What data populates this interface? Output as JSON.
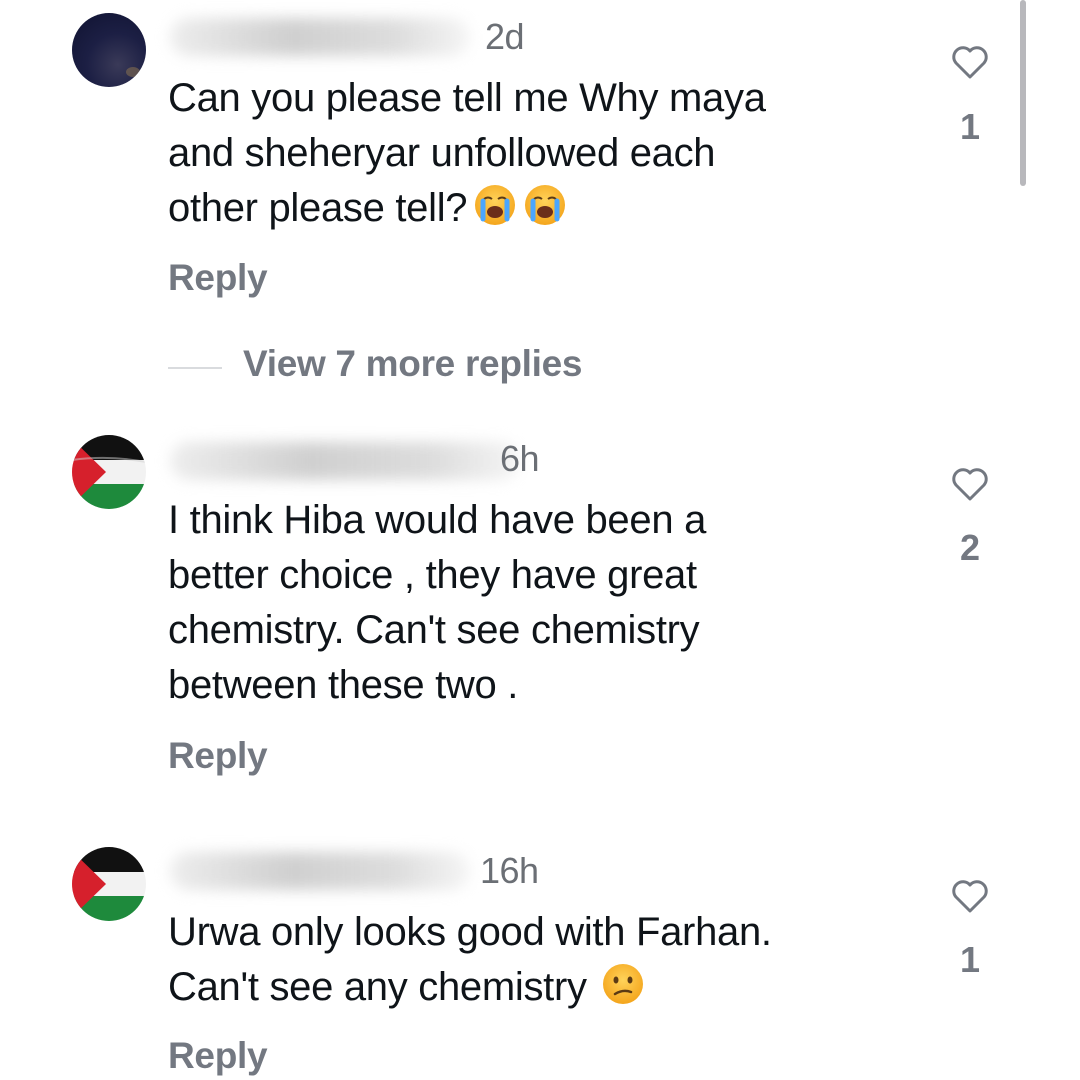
{
  "comments": [
    {
      "avatar": "dark-profile-photo",
      "timestamp": "2d",
      "text": "Can you please tell me Why maya\nand sheheryar unfollowed each\nother please tell?",
      "emojis": [
        "loudly-crying-face",
        "loudly-crying-face"
      ],
      "reply_label": "Reply",
      "likes": "1",
      "heart_icon": "heart-outline-icon"
    },
    {
      "avatar": "palestine-flag",
      "timestamp": "6h",
      "text": "I think Hiba would have been a\nbetter choice , they have great\nchemistry. Can't see chemistry\nbetween these two .",
      "reply_label": "Reply",
      "likes": "2",
      "heart_icon": "heart-outline-icon"
    },
    {
      "avatar": "palestine-flag",
      "timestamp": "16h",
      "text": "Urwa only looks good with Farhan.\nCan't see any chemistry",
      "emojis": [
        "confused-face"
      ],
      "reply_label": "Reply",
      "likes": "1",
      "heart_icon": "heart-outline-icon"
    }
  ],
  "thread": {
    "view_more_label": "View 7 more replies"
  },
  "colors": {
    "text_primary": "#0f1419",
    "text_secondary": "#737881",
    "background": "#ffffff"
  }
}
